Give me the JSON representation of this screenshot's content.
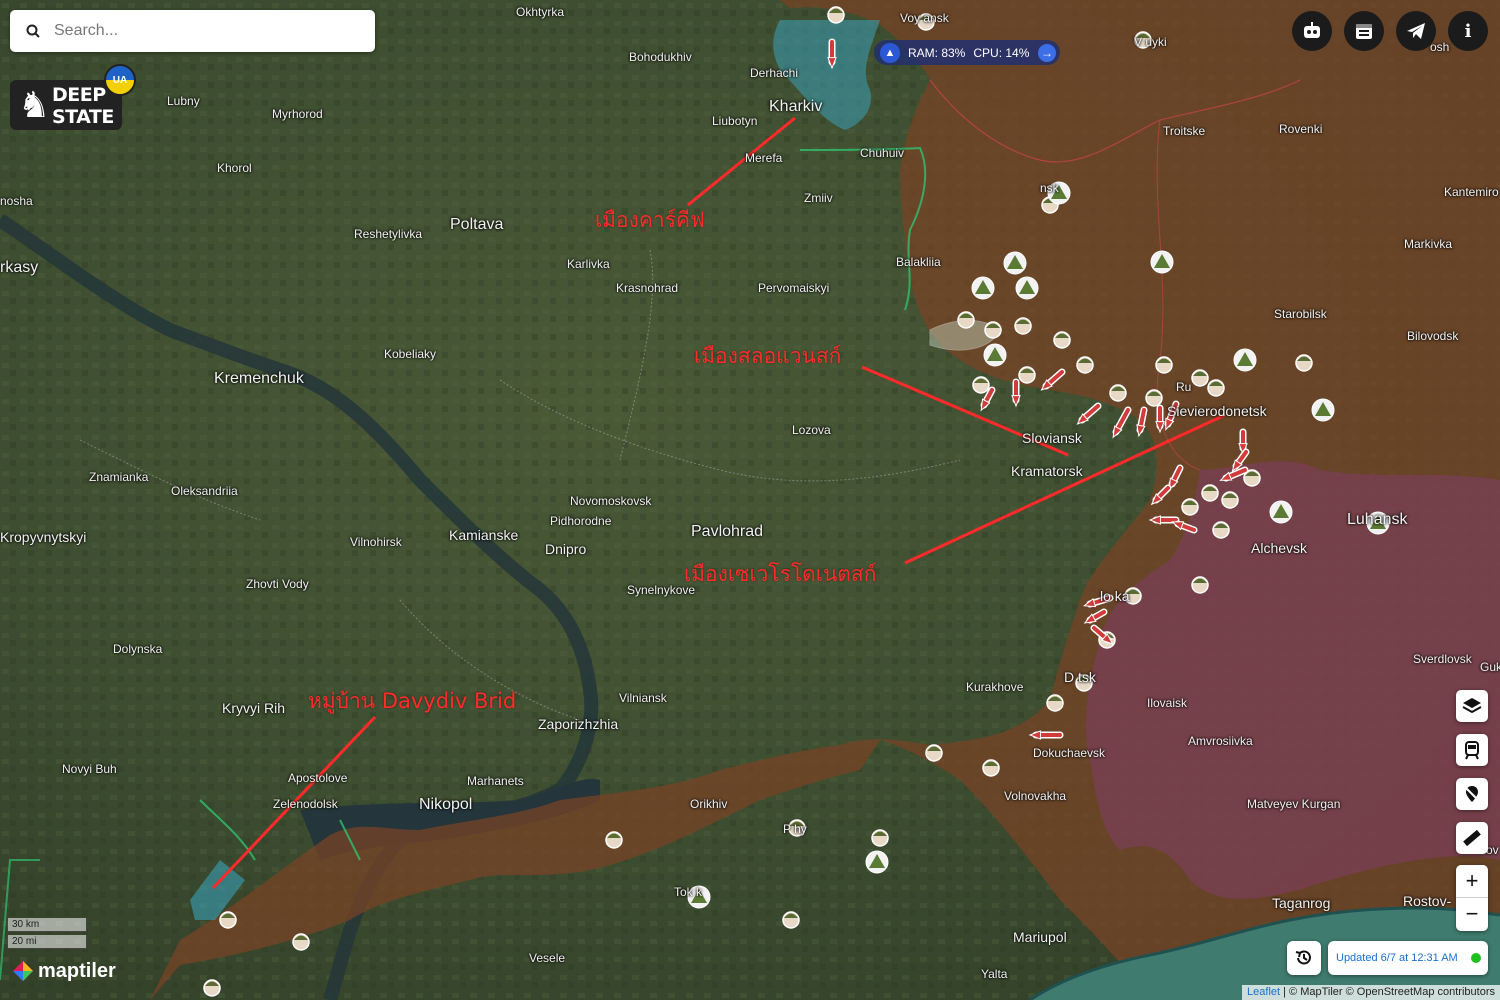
{
  "search": {
    "placeholder": "Search..."
  },
  "logo": {
    "line1": "DEEP",
    "line2": "STATE",
    "badge": "UA"
  },
  "system_monitor": {
    "ram": "RAM: 83%",
    "cpu": "CPU: 14%"
  },
  "top_buttons": [
    "robot-icon",
    "calendar-icon",
    "telegram-icon",
    "info-icon"
  ],
  "side_buttons": [
    "layers-icon",
    "train-icon",
    "no-location-icon",
    "ruler-icon"
  ],
  "zoom": {
    "in": "+",
    "out": "−"
  },
  "status": {
    "updated": "Updated 6/7 at 12:31 AM",
    "status_color": "#1ec01e"
  },
  "scale": {
    "km": "30 km",
    "mi": "20 mi"
  },
  "brand": "maptiler",
  "attribution": {
    "leaflet": "Leaflet",
    "rest": " | © MapTiler © OpenStreetMap contributors"
  },
  "annotations": {
    "kharkiv": "เมืองคาร์คีฟ",
    "sloviansk": "เมืองสลอแวนสก์",
    "sievierodonetsk": "เมืองเซเวโรโดเนตสก์",
    "davydiv": "หมู่บ้าน Davydiv Brid"
  },
  "places": {
    "okhtyrka": "Okhtyrka",
    "bohodukhiv": "Bohodukhiv",
    "derhachi": "Derhachi",
    "kharkiv": "Kharkiv",
    "liubotyn": "Liubotyn",
    "merefa": "Merefa",
    "chuhuiv": "Chuhuiv",
    "zmiiv": "Zmiiv",
    "vovchansk": "Voy  ansk",
    "valuyki": "V  uyki",
    "rossosh": "osh",
    "troitske": "Troitske",
    "rovenki": "Rovenki",
    "kantemirovka": "Kantemiro",
    "markivka": "Markivka",
    "starobilsk": "Starobilsk",
    "bilovodsk": "Bilovodsk",
    "izium": "   nsk",
    "balakliia": "Balakliia",
    "pervomaiskyi": "Pervomaiskyi",
    "lubny": "Lubny",
    "myrhorod": "Myrhorod",
    "khorol": "Khorol",
    "hrebinka": "nosha",
    "cherkasy": "rkasy",
    "reshetylivka": "Reshetylivka",
    "poltava": "Poltava",
    "karlivka": "Karlivka",
    "krasnohrad": "Krasnohrad",
    "kobeliaky": "Kobeliaky",
    "kremenchuk": "Kremenchuk",
    "lozova": "Lozova",
    "sloviansk": "Sloviansk",
    "kramatorsk": "Kramatorsk",
    "sievierodonetsk": "Sievierodonetsk",
    "rubizhne": "Ru",
    "luhansk": "Luhansk",
    "alchevsk": "Alchevsk",
    "znamianka": "Znamianka",
    "oleksandriia": "Oleksandriia",
    "kropyvnytskyi": "Kropyvnytskyi",
    "vilnohirsk": "Vilnohirsk",
    "kamianske": "Kamianske",
    "dnipro": "Dnipro",
    "novomoskovsk": "Novomoskovsk",
    "pidhorodne": "Pidhorodne",
    "pavlohrad": "Pavlohrad",
    "synelnykove": "Synelnykove",
    "horlivka": "  lo  ka",
    "zhovti_vody": "Zhovti Vody",
    "dolynska": "Dolynska",
    "kryvyi_rih": "Kryvyi Rih",
    "novyi_buh": "Novyi Buh",
    "apostolove": "Apostolove",
    "zelenodolsk": "Zelenodolsk",
    "nikopol": "Nikopol",
    "marhanets": "Marhanets",
    "vilniansk": "Vilniansk",
    "zaporizhzhia": "Zaporizhzhia",
    "orikhiv": "Orikhiv",
    "kurakhove": "Kurakhove",
    "donetsk": "D    tsk",
    "ilovaisk": "Ilovaisk",
    "amvrosiivka": "Amvrosiivka",
    "dokuchaevsk": "Dokuchaevsk",
    "volnovakha": "Volnovakha",
    "matveyev_kurgan": "Matveyev Kurgan",
    "sverdlovsk": "Sverdlovsk",
    "gukovo": "Guk",
    "polohy": "P    hy",
    "tokmak": "Tok   k",
    "vesele": "Vesele",
    "mariupol": "Mariupol",
    "yalta": "Yalta",
    "taganrog": "Taganrog",
    "rostov": "Rostov-",
    "novo": "ov"
  },
  "colors": {
    "occupied": "#7a4326",
    "occupied_old": "#6c3a45",
    "liberated": "#3aa0b8",
    "annotation": "#ff2a2a"
  }
}
